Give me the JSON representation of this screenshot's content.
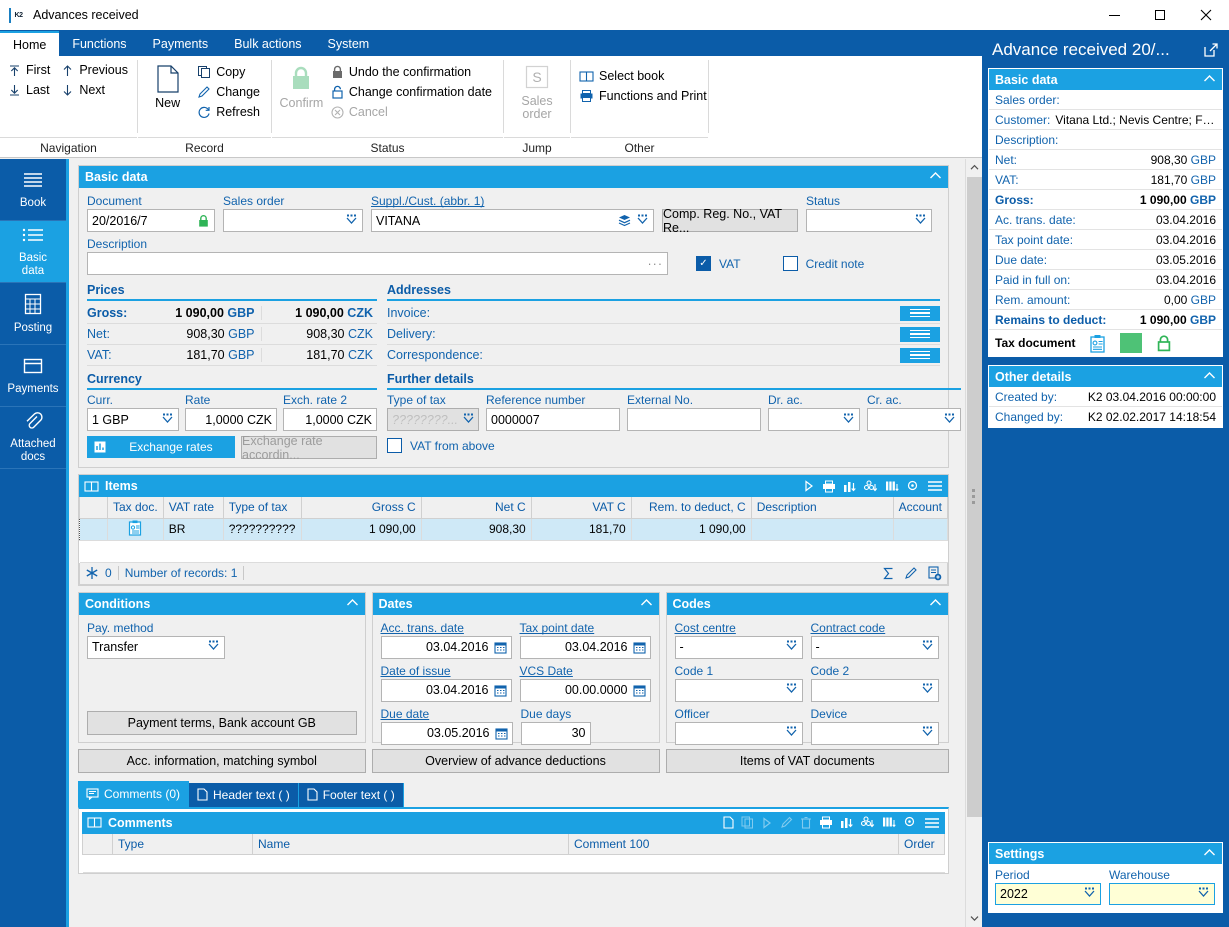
{
  "window": {
    "title": "Advances received",
    "minimize": "–",
    "maximize": "□",
    "close": "✕"
  },
  "ribbon": {
    "tabs": [
      {
        "label": "Home",
        "active": true
      },
      {
        "label": "Functions",
        "active": false
      },
      {
        "label": "Payments",
        "active": false
      },
      {
        "label": "Bulk actions",
        "active": false
      },
      {
        "label": "System",
        "active": false
      }
    ],
    "groups": [
      {
        "name": "Navigation",
        "items": [
          {
            "label": "First",
            "icon": "arrow-up-to-line-icon"
          },
          {
            "label": "Previous",
            "icon": "arrow-up-icon"
          },
          {
            "label": "Last",
            "icon": "arrow-down-to-line-icon"
          },
          {
            "label": "Next",
            "icon": "arrow-down-icon"
          }
        ]
      },
      {
        "name": "Record",
        "big": {
          "label": "New",
          "icon": "page-icon"
        },
        "items": [
          {
            "label": "Copy",
            "icon": "copy-icon"
          },
          {
            "label": "Change",
            "icon": "pencil-icon"
          },
          {
            "label": "Refresh",
            "icon": "refresh-icon"
          }
        ]
      },
      {
        "name": "Status",
        "big": {
          "label": "Confirm",
          "icon": "lock-icon",
          "disabled": true
        },
        "items": [
          {
            "label": "Undo the confirmation",
            "icon": "lock-closed-icon"
          },
          {
            "label": "Change confirmation date",
            "icon": "lock-open-icon"
          },
          {
            "label": "Cancel",
            "icon": "cancel-circle-icon",
            "disabled": true
          }
        ]
      },
      {
        "name": "Jump",
        "big": {
          "label": "Sales order",
          "icon": "s-box-icon",
          "disabled": true
        }
      },
      {
        "name": "Other",
        "items": [
          {
            "label": "Select book",
            "icon": "book-icon"
          },
          {
            "label": "Functions and Print",
            "icon": "printer-icon"
          }
        ]
      }
    ]
  },
  "sidebar": {
    "items": [
      {
        "label": "Book",
        "icon": "lines-icon",
        "active": false
      },
      {
        "label": "Basic\ndata",
        "label_line1": "Basic",
        "label_line2": "data",
        "icon": "list-icon",
        "active": true
      },
      {
        "label": "Posting",
        "icon": "calculator-icon",
        "active": false
      },
      {
        "label": "Payments",
        "icon": "tray-icon",
        "active": false
      },
      {
        "label": "Attached docs",
        "label_line1": "Attached",
        "label_line2": "docs",
        "icon": "paperclip-icon",
        "active": false
      }
    ]
  },
  "basic_data": {
    "panel_title": "Basic data",
    "document_label": "Document",
    "document_value": "20/2016/7",
    "sales_order_label": "Sales order",
    "sales_order_value": "",
    "supplier_label": "Suppl./Cust. (abbr. 1)",
    "supplier_value": "VITANA",
    "comp_reg_button": "Comp. Reg. No., VAT Re...",
    "status_label": "Status",
    "status_value": "",
    "description_label": "Description",
    "description_value": "",
    "vat_checkbox": "VAT",
    "vat_checked": true,
    "credit_note_checkbox": "Credit note",
    "credit_note_checked": false
  },
  "prices": {
    "title": "Prices",
    "rows": [
      {
        "label": "Gross:",
        "amount1": "1 090,00",
        "cur1": "GBP",
        "amount2": "1 090,00",
        "cur2": "CZK",
        "bold": true
      },
      {
        "label": "Net:",
        "amount1": "908,30",
        "cur1": "GBP",
        "amount2": "908,30",
        "cur2": "CZK",
        "bold": false
      },
      {
        "label": "VAT:",
        "amount1": "181,70",
        "cur1": "GBP",
        "amount2": "181,70",
        "cur2": "CZK",
        "bold": false
      }
    ]
  },
  "addresses": {
    "title": "Addresses",
    "rows": [
      {
        "label": "Invoice:"
      },
      {
        "label": "Delivery:"
      },
      {
        "label": "Correspondence:"
      }
    ]
  },
  "currency": {
    "title": "Currency",
    "curr_label": "Curr.",
    "curr_value": "1 GBP",
    "rate_label": "Rate",
    "rate_value": "1,0000 CZK",
    "exch2_label": "Exch. rate 2",
    "exch2_value": "1,0000 CZK",
    "exchange_rates_button": "Exchange rates",
    "exchange_rate_according_button": "Exchange rate accordin..."
  },
  "further_details": {
    "title": "Further details",
    "type_of_tax_label": "Type of tax",
    "type_of_tax_value": "????????...",
    "reference_number_label": "Reference number",
    "reference_number_value": "0000007",
    "external_no_label": "External No.",
    "external_no_value": "",
    "dr_ac_label": "Dr. ac.",
    "dr_ac_value": "",
    "cr_ac_label": "Cr. ac.",
    "cr_ac_value": "",
    "vat_from_above": "VAT from above",
    "vat_from_above_checked": false
  },
  "items": {
    "title": "Items",
    "columns": [
      "",
      "Tax doc.",
      "VAT rate",
      "Type of tax",
      "Gross C",
      "Net C",
      "VAT C",
      "Rem. to deduct, C",
      "Description",
      "Account"
    ],
    "rows": [
      {
        "tax_doc_icon": "tax-document-icon",
        "vat_rate": "BR",
        "type_of_tax": "??????????",
        "gross_c": "1 090,00",
        "net_c": "908,30",
        "vat_c": "181,70",
        "rem_to_deduct_c": "1 090,00",
        "description": "",
        "account": ""
      }
    ],
    "footer_count": "0",
    "footer_records": "Number of records: 1",
    "toolbar_icons": [
      "play-icon",
      "printer-icon",
      "chart-icon",
      "group-icon",
      "columns-icon",
      "settings-icon",
      "menu-icon"
    ],
    "footer_icons": [
      "sum-icon",
      "pencil-icon",
      "add-record-icon"
    ]
  },
  "conditions": {
    "title": "Conditions",
    "pay_method_label": "Pay. method",
    "pay_method_value": "Transfer",
    "payment_terms_button": "Payment terms, Bank account GB",
    "acc_information_button": "Acc. information, matching symbol"
  },
  "dates": {
    "title": "Dates",
    "acc_trans_date_label": "Acc. trans. date",
    "acc_trans_date_value": "03.04.2016",
    "tax_point_date_label": "Tax point date",
    "tax_point_date_value": "03.04.2016",
    "date_of_issue_label": "Date of issue",
    "date_of_issue_value": "03.04.2016",
    "vcs_date_label": "VCS Date",
    "vcs_date_value": "00.00.0000",
    "due_date_label": "Due date",
    "due_date_value": "03.05.2016",
    "due_days_label": "Due days",
    "due_days_value": "30",
    "overview_button": "Overview of advance deductions"
  },
  "codes": {
    "title": "Codes",
    "cost_centre_label": "Cost centre",
    "cost_centre_value": "-",
    "contract_code_label": "Contract code",
    "contract_code_value": "-",
    "code1_label": "Code 1",
    "code1_value": "",
    "code2_label": "Code 2",
    "code2_value": "",
    "officer_label": "Officer",
    "officer_value": "",
    "device_label": "Device",
    "device_value": "",
    "items_vat_button": "Items of VAT documents"
  },
  "bottom_tabs": [
    {
      "label": "Comments (0)",
      "icon": "comment-icon",
      "active": true
    },
    {
      "label": "Header text ( )",
      "icon": "page-icon",
      "active": false
    },
    {
      "label": "Footer text ( )",
      "icon": "page-icon",
      "active": false
    }
  ],
  "comments": {
    "title": "Comments",
    "columns": [
      "",
      "Type",
      "Name",
      "Comment 100",
      "Order"
    ],
    "toolbar_icons": [
      "new-icon",
      "copy-icon",
      "play-icon",
      "pencil-icon",
      "delete-icon",
      "printer-icon",
      "chart-icon",
      "group-icon",
      "columns-icon",
      "settings-icon",
      "menu-icon"
    ]
  },
  "right_pane": {
    "title": "Advance received 20/...",
    "popout_icon": "popout-icon",
    "basic_data": {
      "title": "Basic data",
      "rows": [
        {
          "key": "Sales order:",
          "value": ""
        },
        {
          "key": "Customer:",
          "value": "Vitana Ltd.; Nevis Centre; For...",
          "inline": true
        },
        {
          "key": "Description:",
          "value": ""
        },
        {
          "key": "Net:",
          "value": "908,30",
          "cur": "GBP"
        },
        {
          "key": "VAT:",
          "value": "181,70",
          "cur": "GBP"
        },
        {
          "key": "Gross:",
          "value": "1 090,00",
          "cur": "GBP",
          "bold": true
        },
        {
          "key": "Ac. trans. date:",
          "value": "03.04.2016"
        },
        {
          "key": "Tax point date:",
          "value": "03.04.2016"
        },
        {
          "key": "Due date:",
          "value": "03.05.2016"
        },
        {
          "key": "Paid in full on:",
          "value": "03.04.2016"
        },
        {
          "key": "Rem. amount:",
          "value": "0,00",
          "cur": "GBP"
        },
        {
          "key": "Remains to deduct:",
          "value": "1 090,00",
          "cur": "GBP",
          "bold": true
        }
      ],
      "tax_document_label": "Tax document",
      "tax_document_icons": [
        "tax-document-icon",
        "green-square-icon",
        "green-lock-icon"
      ]
    },
    "other_details": {
      "title": "Other details",
      "rows": [
        {
          "key": "Created by:",
          "value": "K2 03.04.2016 00:00:00"
        },
        {
          "key": "Changed by:",
          "value": "K2 02.02.2017 14:18:54"
        }
      ]
    },
    "settings": {
      "title": "Settings",
      "period_label": "Period",
      "period_value": "2022",
      "warehouse_label": "Warehouse",
      "warehouse_value": ""
    }
  },
  "colors": {
    "accent_dark": "#0b5ca8",
    "accent_light": "#1ba1e2",
    "row_selected": "#cfe9f7",
    "label_blue": "#1163ad",
    "green": "#4ec276"
  }
}
